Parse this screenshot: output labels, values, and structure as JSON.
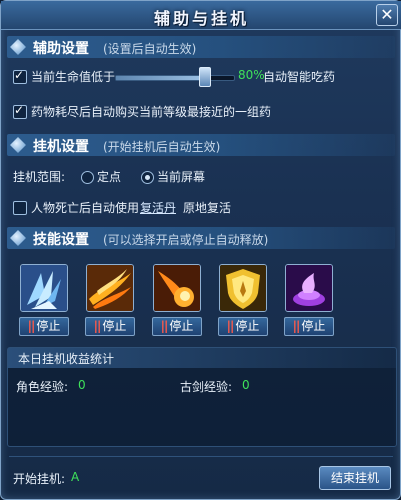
{
  "window": {
    "title": "辅助与挂机",
    "close_label": "✕"
  },
  "assist": {
    "heading": "辅助设置",
    "sub": "(设置后自动生效)",
    "hp_label": "当前生命值低于",
    "hp_value_text": "80%",
    "hp_level": 0.8,
    "hp_action": "自动智能吃药",
    "auto_buy_label": "药物耗尽后自动购买当前等级最接近的一组药"
  },
  "hangup": {
    "heading": "挂机设置",
    "sub": "(开始挂机后自动生效)",
    "range_label": "挂机范围:",
    "range_options": [
      "定点",
      "当前屏幕"
    ],
    "range_selected": "当前屏幕",
    "revive_prefix": "人物死亡后自动使用",
    "revive_link": "复活丹",
    "revive_suffix": "原地复活"
  },
  "skills": {
    "heading": "技能设置",
    "sub": "(可以选择开启或停止自动释放)",
    "items": [
      {
        "icon": "ice-shard-skill-icon",
        "button": "停止"
      },
      {
        "icon": "flame-slash-skill-icon",
        "button": "停止"
      },
      {
        "icon": "fireball-skill-icon",
        "button": "停止"
      },
      {
        "icon": "golden-shield-skill-icon",
        "button": "停止"
      },
      {
        "icon": "purple-vortex-skill-icon",
        "button": "停止"
      }
    ]
  },
  "stats": {
    "heading": "本日挂机收益统计",
    "role_exp_label": "角色经验:",
    "role_exp_value": "0",
    "sword_exp_label": "古剑经验:",
    "sword_exp_value": "0"
  },
  "footer": {
    "start_label": "开始挂机:",
    "start_value": "A",
    "end_button": "结束挂机"
  },
  "colors": {
    "accent_green": "#3fe25a",
    "stop_bars": "#ff5a4a"
  }
}
